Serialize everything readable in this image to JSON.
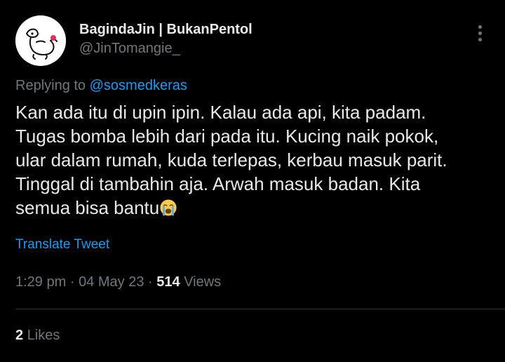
{
  "author": {
    "display_name": "BagindaJin | BukanPentol",
    "handle": "@JinTomangie_",
    "avatar_icon": "dog-sketch-avatar"
  },
  "more_icon": "more-vertical-icon",
  "reply": {
    "prefix": "Replying to",
    "mention": "@sosmedkeras"
  },
  "body": {
    "lines": [
      "Kan ada itu di upin ipin. Kalau ada api, kita padam.",
      "Tugas bomba lebih dari pada itu. Kucing naik pokok,",
      "ular dalam rumah, kuda terlepas, kerbau masuk parit.",
      "Tinggal di tambahin aja. Arwah masuk badan. Kita",
      "semua bisa bantu"
    ],
    "emoji": "loudly-crying-face-icon"
  },
  "translate_label": "Translate Tweet",
  "meta": {
    "time": "1:29 pm",
    "date": "04 May 23",
    "separator": "·",
    "views_count": "514",
    "views_label": "Views"
  },
  "stats": {
    "likes_count": "2",
    "likes_label": "Likes"
  },
  "colors": {
    "background": "#000000",
    "text": "#e7e9ea",
    "secondary": "#71767b",
    "accent": "#1d9bf0",
    "divider": "#2f3336"
  }
}
